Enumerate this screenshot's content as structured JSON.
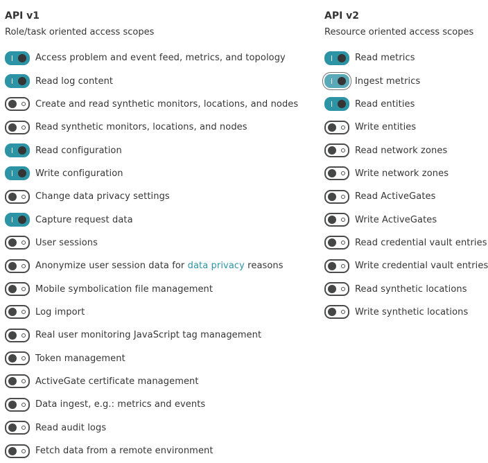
{
  "api_v1": {
    "title": "API v1",
    "subtitle": "Role/task oriented access scopes",
    "scopes": [
      {
        "label": "Access problem and event feed, metrics, and topology",
        "enabled": true
      },
      {
        "label": "Read log content",
        "enabled": true
      },
      {
        "label": "Create and read synthetic monitors, locations, and nodes",
        "enabled": false
      },
      {
        "label": "Read synthetic monitors, locations, and nodes",
        "enabled": false
      },
      {
        "label": "Read configuration",
        "enabled": true
      },
      {
        "label": "Write configuration",
        "enabled": true
      },
      {
        "label": "Change data privacy settings",
        "enabled": false
      },
      {
        "label": "Capture request data",
        "enabled": true
      },
      {
        "label": "User sessions",
        "enabled": false
      },
      {
        "label_before": "Anonymize user session data for ",
        "link": "data privacy",
        "label_after": " reasons",
        "enabled": false
      },
      {
        "label": "Mobile symbolication file management",
        "enabled": false
      },
      {
        "label": "Log import",
        "enabled": false
      },
      {
        "label": "Real user monitoring JavaScript tag management",
        "enabled": false
      },
      {
        "label": "Token management",
        "enabled": false
      },
      {
        "label": "ActiveGate certificate management",
        "enabled": false
      },
      {
        "label": "Data ingest, e.g.: metrics and events",
        "enabled": false
      },
      {
        "label": "Read audit logs",
        "enabled": false
      },
      {
        "label": "Fetch data from a remote environment",
        "enabled": false
      }
    ]
  },
  "api_v2": {
    "title": "API v2",
    "subtitle": "Resource oriented access scopes",
    "scopes": [
      {
        "label": "Read metrics",
        "enabled": true
      },
      {
        "label": "Ingest metrics",
        "enabled": true,
        "focused": true
      },
      {
        "label": "Read entities",
        "enabled": true
      },
      {
        "label": "Write entities",
        "enabled": false
      },
      {
        "label": "Read network zones",
        "enabled": false
      },
      {
        "label": "Write network zones",
        "enabled": false
      },
      {
        "label": "Read ActiveGates",
        "enabled": false
      },
      {
        "label": "Write ActiveGates",
        "enabled": false
      },
      {
        "label": "Read credential vault entries",
        "enabled": false
      },
      {
        "label": "Write credential vault entries",
        "enabled": false
      },
      {
        "label": "Read synthetic locations",
        "enabled": false
      },
      {
        "label": "Write synthetic locations",
        "enabled": false
      }
    ]
  },
  "colors": {
    "toggle_on": "#2d94a6",
    "toggle_off_border": "#4b4b4b",
    "link": "#2d94a6",
    "text": "#353535"
  }
}
